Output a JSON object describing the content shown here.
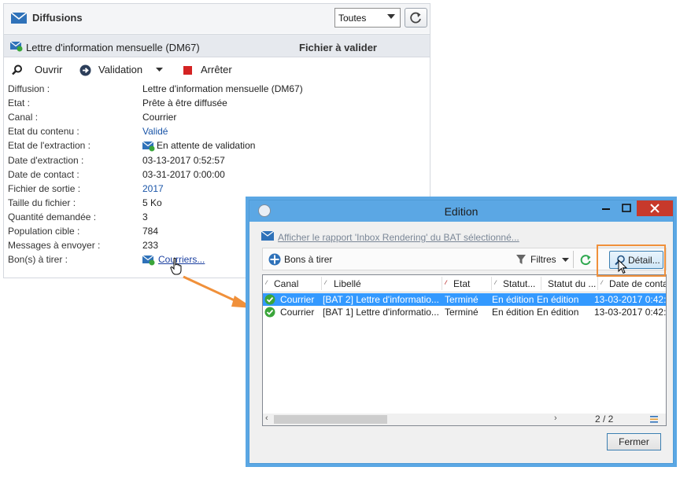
{
  "panel": {
    "title": "Diffusions",
    "filter_selected": "Toutes",
    "delivery_name": "Lettre d'information mensuelle (DM67)",
    "delivery_status": "Fichier à valider",
    "actions": {
      "open": "Ouvrir",
      "validation": "Validation",
      "stop": "Arrêter"
    },
    "properties": [
      {
        "label": "Diffusion :",
        "value": "Lettre d'information mensuelle (DM67)"
      },
      {
        "label": "Etat :",
        "value": "Prête à être diffusée"
      },
      {
        "label": "Canal :",
        "value": "Courrier"
      },
      {
        "label": "Etat du contenu :",
        "value": "Validé"
      },
      {
        "label": "Etat de l'extraction :",
        "value": "En attente de validation"
      },
      {
        "label": "Date d'extraction :",
        "value": "03-13-2017 0:52:57"
      },
      {
        "label": "Date de contact :",
        "value": "03-31-2017 0:00:00"
      },
      {
        "label": "Fichier de sortie :",
        "value": "2017"
      },
      {
        "label": "Taille du fichier :",
        "value": "5 Ko"
      },
      {
        "label": "Quantité demandée :",
        "value": "3"
      },
      {
        "label": "Population cible :",
        "value": "784"
      },
      {
        "label": "Messages à envoyer :",
        "value": "233"
      },
      {
        "label": "Bon(s) à tirer :",
        "value": "Courriers..."
      }
    ]
  },
  "dialog": {
    "title": "Edition",
    "inbox_link": "Afficher le rapport 'Inbox Rendering' du BAT sélectionné...",
    "toolbar": {
      "proofs": "Bons à tirer",
      "filters": "Filtres",
      "detail": "Détail..."
    },
    "columns": [
      "Canal",
      "Libellé",
      "Etat",
      "Statut...",
      "Statut du ...",
      "Date de conta"
    ],
    "rows": [
      {
        "canal": "Courrier",
        "libelle": "[BAT 2] Lettre d'informatio...",
        "etat": "Terminé",
        "statut": "En édition",
        "statut_du": "En édition",
        "date": "13-03-2017 0:42:"
      },
      {
        "canal": "Courrier",
        "libelle": "[BAT 1] Lettre d'informatio...",
        "etat": "Terminé",
        "statut": "En édition",
        "statut_du": "En édition",
        "date": "13-03-2017 0:42:"
      }
    ],
    "pager": "2 / 2",
    "close_label": "Fermer"
  },
  "colors": {
    "accent": "#1a55a8",
    "highlight": "#f0903a",
    "selection": "#3399ff",
    "titlebar": "#5ba7e4"
  }
}
